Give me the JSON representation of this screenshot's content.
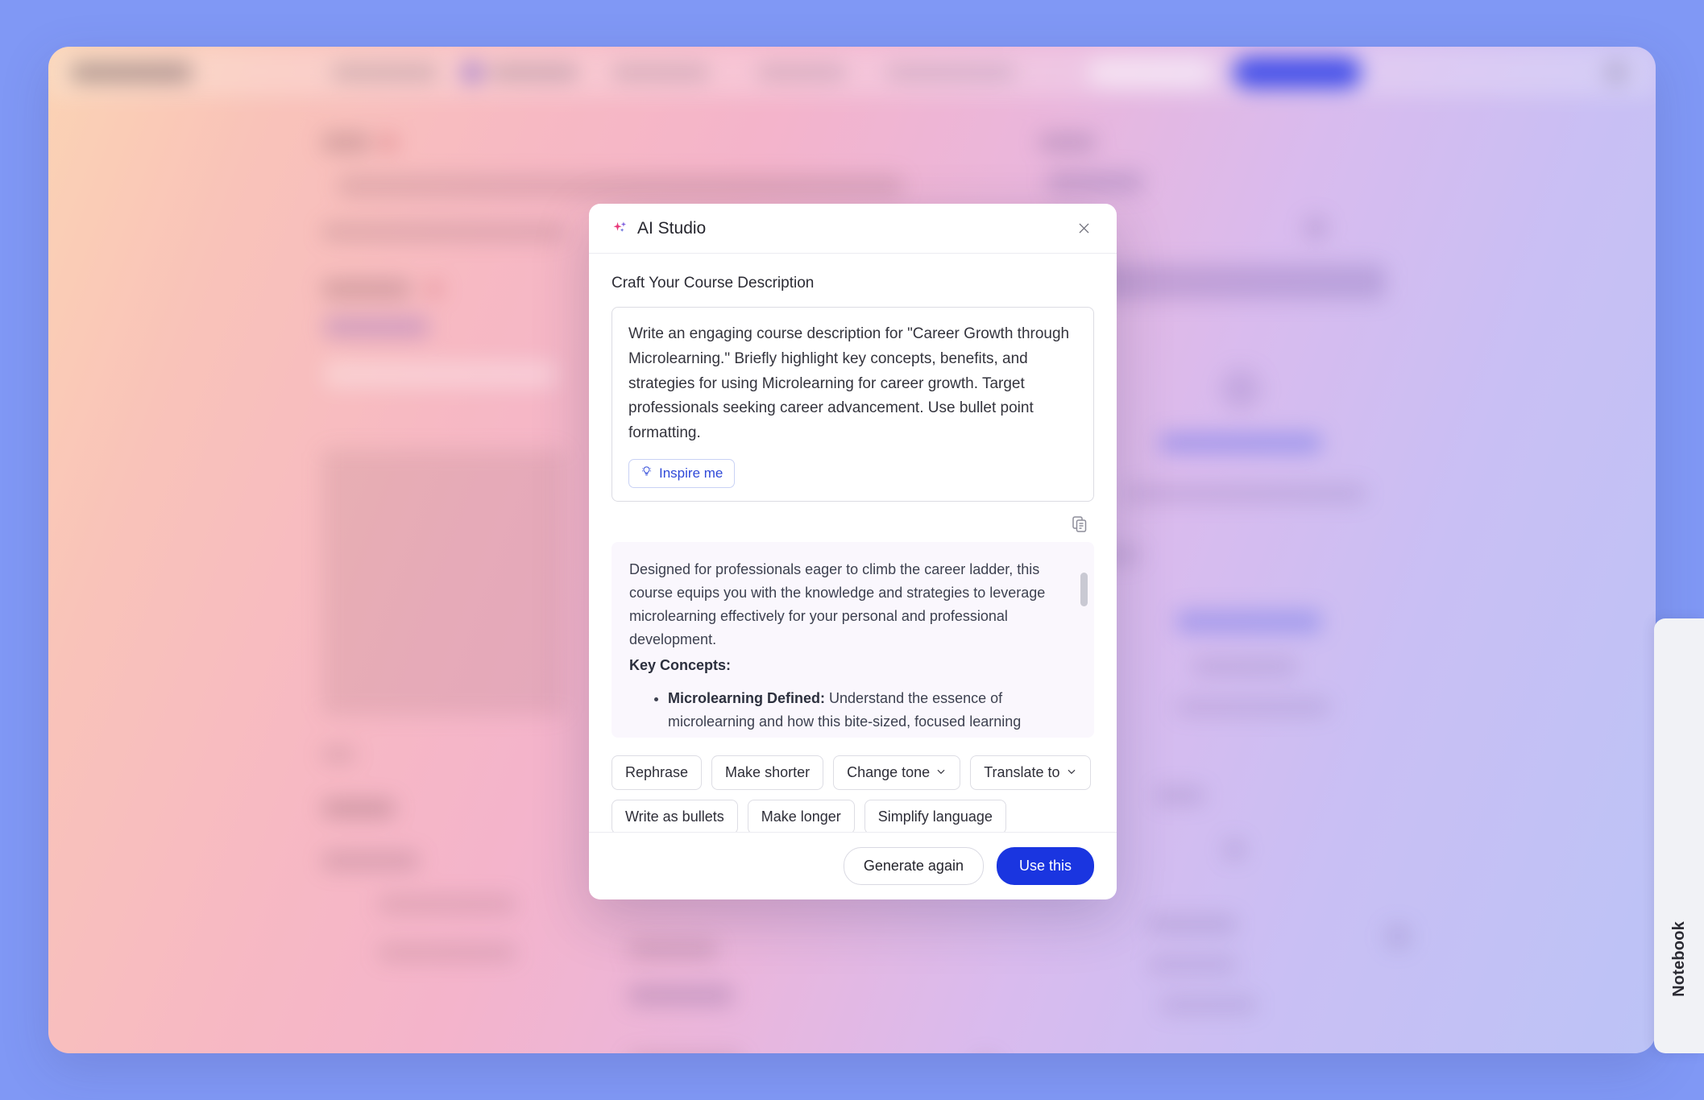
{
  "background_app": {
    "notebook_tab_label": "Notebook",
    "outer_bg_color": "#8098f5",
    "note": "application behind modal is blurred and unreadable"
  },
  "modal": {
    "title": "AI Studio",
    "icon": "sparkle-icon",
    "close_icon": "close-icon",
    "section_label": "Craft Your Course Description",
    "prompt": {
      "value": "Write an engaging course description for \"Career Growth through Microlearning.\" Briefly highlight key concepts, benefits, and strategies for using Microlearning for career growth. Target professionals seeking career advancement. Use bullet point formatting.",
      "placeholder": "Describe what you want to generate",
      "inspire_label": "Inspire me",
      "inspire_icon": "lightbulb-icon"
    },
    "result": {
      "copy_icon": "copy-icon",
      "paragraph": "Designed for professionals eager to climb the career ladder, this course equips you with the knowledge and strategies to leverage microlearning effectively for your personal and professional development.",
      "heading": "Key Concepts:",
      "bullets": [
        {
          "term": "Microlearning Defined:",
          "text": " Understand the essence of microlearning and how this bite-sized, focused learning"
        }
      ]
    },
    "chips_row1": [
      {
        "label": "Rephrase",
        "has_chevron": false
      },
      {
        "label": "Make shorter",
        "has_chevron": false
      },
      {
        "label": "Change tone",
        "has_chevron": true
      },
      {
        "label": "Translate to",
        "has_chevron": true
      }
    ],
    "chips_row2": [
      {
        "label": "Write as bullets",
        "has_chevron": false
      },
      {
        "label": "Make longer",
        "has_chevron": false
      },
      {
        "label": "Simplify language",
        "has_chevron": false
      }
    ],
    "footer": {
      "secondary_label": "Generate again",
      "primary_label": "Use this",
      "primary_color": "#1a35e0"
    }
  }
}
